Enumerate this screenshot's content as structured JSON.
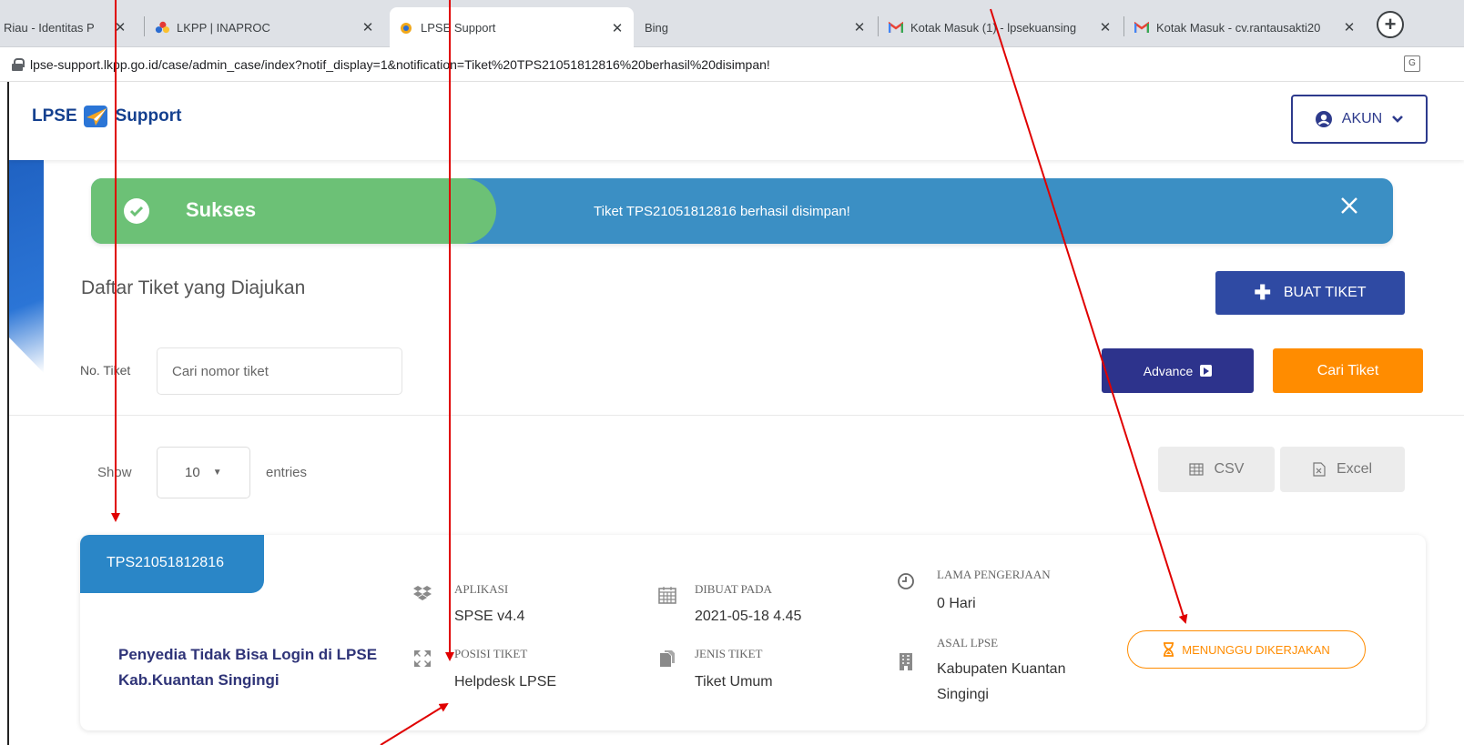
{
  "browser": {
    "tabs": [
      {
        "title": "Riau - Identitas P",
        "favicon": "partial-favicon"
      },
      {
        "title": "LKPP | INAPROC",
        "favicon": "lkpp-favicon"
      },
      {
        "title": "LPSE Support",
        "favicon": "lpse-favicon"
      },
      {
        "title": "Bing",
        "favicon": "none"
      },
      {
        "title": "Kotak Masuk (1) - lpsekuansing",
        "favicon": "gmail-icon"
      },
      {
        "title": "Kotak Masuk - cv.rantausakti20",
        "favicon": "gmail-icon"
      }
    ],
    "url": "lpse-support.lkpp.go.id/case/admin_case/index?notif_display=1&notification=Tiket%20TPS21051812816%20berhasil%20disimpan!"
  },
  "header": {
    "brand_left": "LPSE",
    "brand_right": "Support",
    "account_label": "AKUN"
  },
  "banner": {
    "title": "Sukses",
    "message": "Tiket TPS21051812816 berhasil disimpan!"
  },
  "page": {
    "title": "Daftar Tiket yang Diajukan",
    "create_button": "BUAT TIKET",
    "search_label": "No. Tiket",
    "search_placeholder": "Cari nomor tiket",
    "advance_button": "Advance",
    "search_button": "Cari Tiket",
    "show_label": "Show",
    "entries_value": "10",
    "entries_label": "entries",
    "csv_button": "CSV",
    "excel_button": "Excel"
  },
  "ticket": {
    "number": "TPS21051812816",
    "subject": "Penyedia Tidak Bisa Login di LPSE Kab.Kuantan Singingi",
    "aplikasi_label": "APLIKASI",
    "aplikasi_value": "SPSE v4.4",
    "posisi_label": "POSISI TIKET",
    "posisi_value": "Helpdesk LPSE",
    "dibuat_label": "DIBUAT PADA",
    "dibuat_value": "2021-05-18 4.45",
    "jenis_label": "JENIS TIKET",
    "jenis_value": "Tiket Umum",
    "lama_label": "LAMA PENGERJAAN",
    "lama_value": "0 Hari",
    "asal_label": "ASAL LPSE",
    "asal_value": "Kabupaten Kuantan Singingi",
    "status": "MENUNGGU DIKERJAKAN"
  },
  "colors": {
    "brand_navy": "#2d3a8c",
    "success_green": "#6cc176",
    "banner_blue": "#3b8fc4",
    "ticket_blue": "#2a86c7",
    "action_orange": "#ff8c00",
    "annotation_red": "#e00000"
  }
}
